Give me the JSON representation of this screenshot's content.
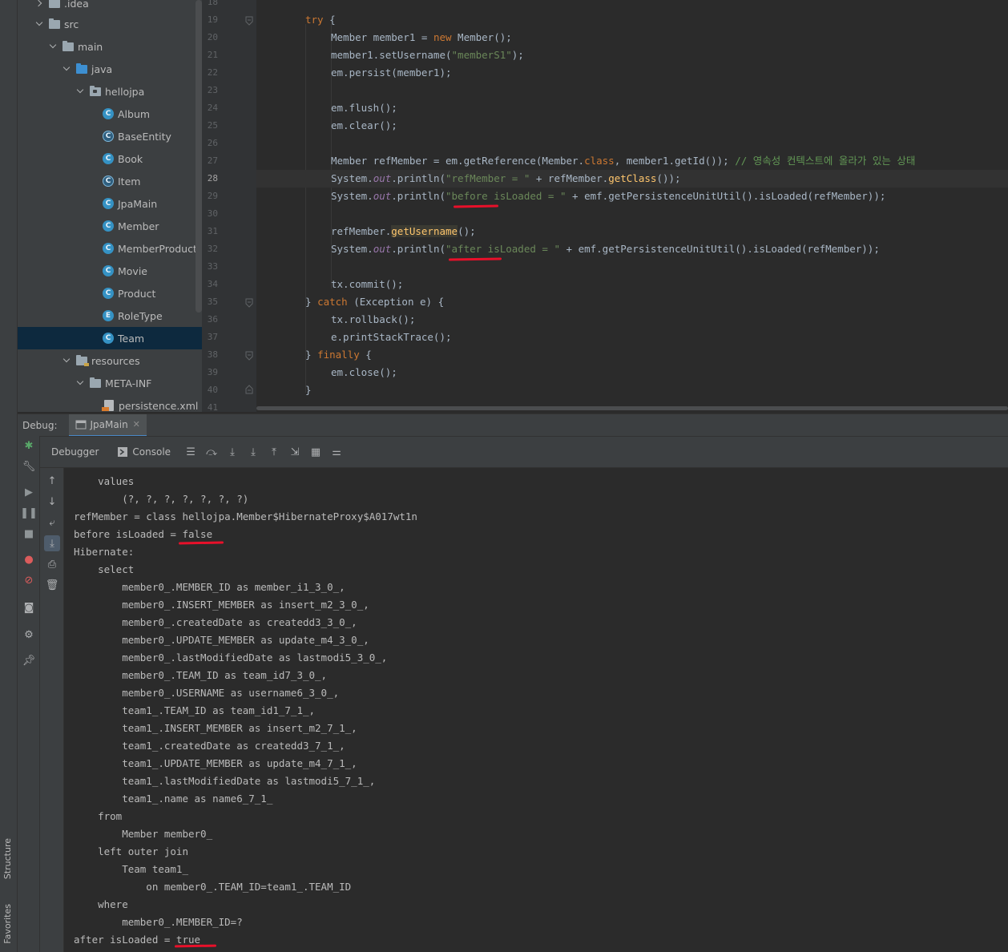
{
  "sidebar": {
    "structure_label": "Structure",
    "favorites_label": "Favorites"
  },
  "tree": {
    "idea": ".idea",
    "src": "src",
    "main": "main",
    "java": "java",
    "hellojpa": "hellojpa",
    "classes": [
      "Album",
      "BaseEntity",
      "Book",
      "Item",
      "JpaMain",
      "Member",
      "MemberProduct",
      "Movie",
      "Product",
      "RoleType",
      "Team"
    ],
    "class_badges": [
      "C",
      "C",
      "C",
      "C",
      "C",
      "C",
      "C",
      "C",
      "C",
      "E",
      "C"
    ],
    "selected": "Team",
    "resources": "resources",
    "meta_inf": "META-INF",
    "persistence": "persistence.xml"
  },
  "editor": {
    "line_numbers": [
      "18",
      "19",
      "20",
      "21",
      "22",
      "23",
      "24",
      "25",
      "26",
      "27",
      "28",
      "29",
      "30",
      "31",
      "32",
      "33",
      "34",
      "35",
      "36",
      "37",
      "38",
      "39",
      "40",
      "41"
    ],
    "current_line": "28",
    "code": {
      "l19_try": "try",
      "l19_brace": " {",
      "l20_a": "Member member1 = ",
      "l20_new": "new",
      "l20_b": " Member();",
      "l21_a": "member1.setUsername(",
      "l21_str": "\"memberS1\"",
      "l21_b": ");",
      "l22": "em.persist(member1);",
      "l24": "em.flush();",
      "l25": "em.clear();",
      "l27_a": "Member refMember = em.getReference(Member.",
      "l27_class": "class",
      "l27_b": ", member1.getId()); ",
      "l27_cmt": "// 영속성 컨텍스트에 올라가 있는 상태",
      "l28_a": "System.",
      "l28_out": "out",
      "l28_b": ".println(",
      "l28_str": "\"refMember = \"",
      "l28_c": " + refMember.",
      "l28_m": "getClass",
      "l28_d": "());",
      "l29_a": "System.",
      "l29_out": "out",
      "l29_b": ".println(",
      "l29_str": "\"before isLoaded = \"",
      "l29_c": " + emf.getPersistenceUnitUtil().isLoaded(refMember));",
      "l31_a": "refMember.",
      "l31_m": "getUsername",
      "l31_b": "();",
      "l32_a": "System.",
      "l32_out": "out",
      "l32_b": ".println(",
      "l32_str": "\"after isLoaded = \"",
      "l32_c": " + emf.getPersistenceUnitUtil().isLoaded(refMember));",
      "l34": "tx.commit();",
      "l35_a": "} ",
      "l35_catch": "catch",
      "l35_b": " (Exception e) {",
      "l36": "tx.rollback();",
      "l37": "e.printStackTrace();",
      "l38_a": "} ",
      "l38_finally": "finally",
      "l38_b": " {",
      "l39": "em.close();",
      "l40": "}"
    }
  },
  "debug": {
    "label": "Debug:",
    "tab": "JpaMain",
    "tabs": [
      "Debugger",
      "Console"
    ]
  },
  "console": {
    "lines": [
      "    values",
      "        (?, ?, ?, ?, ?, ?, ?)",
      "refMember = class hellojpa.Member$HibernateProxy$A017wt1n",
      "before isLoaded = false",
      "Hibernate:",
      "    select",
      "        member0_.MEMBER_ID as member_i1_3_0_,",
      "        member0_.INSERT_MEMBER as insert_m2_3_0_,",
      "        member0_.createdDate as createdd3_3_0_,",
      "        member0_.UPDATE_MEMBER as update_m4_3_0_,",
      "        member0_.lastModifiedDate as lastmodi5_3_0_,",
      "        member0_.TEAM_ID as team_id7_3_0_,",
      "        member0_.USERNAME as username6_3_0_,",
      "        team1_.TEAM_ID as team_id1_7_1_,",
      "        team1_.INSERT_MEMBER as insert_m2_7_1_,",
      "        team1_.createdDate as createdd3_7_1_,",
      "        team1_.UPDATE_MEMBER as update_m4_7_1_,",
      "        team1_.lastModifiedDate as lastmodi5_7_1_,",
      "        team1_.name as name6_7_1_",
      "    from",
      "        Member member0_",
      "    left outer join",
      "        Team team1_",
      "            on member0_.TEAM_ID=team1_.TEAM_ID",
      "    where",
      "        member0_.MEMBER_ID=?",
      "after isLoaded = true"
    ]
  },
  "colors": {
    "keyword": "#cc7832",
    "string": "#6a8759",
    "comment": "#629755",
    "annotation_red": "#e8102a",
    "selection": "#0d293e"
  }
}
